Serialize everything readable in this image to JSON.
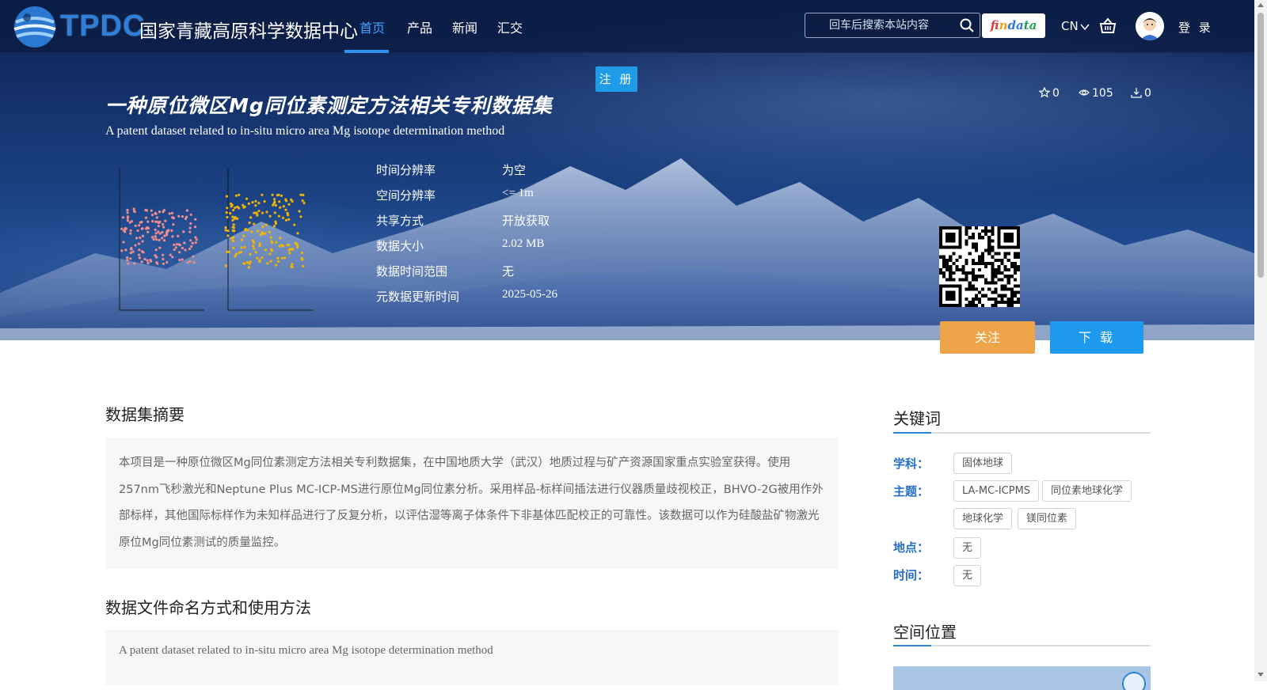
{
  "header": {
    "logo_abbr": "TPDC",
    "logo_name": "国家青藏高原科学数据中心",
    "nav": [
      {
        "label": "首页",
        "active": true
      },
      {
        "label": "产品",
        "active": false
      },
      {
        "label": "新闻",
        "active": false
      },
      {
        "label": "汇交",
        "active": false
      }
    ],
    "search_placeholder": "回车后搜索本站内容",
    "findata": [
      "f",
      "in",
      "da",
      "ta"
    ],
    "lang": "CN",
    "login": "登 录"
  },
  "register_label": "注 册",
  "dataset": {
    "title_cn": "一种原位微区Mg同位素测定方法相关专利数据集",
    "title_en": "A patent dataset related to in-situ micro area Mg isotope determination method",
    "stats": {
      "stars": "0",
      "views": "105",
      "downloads": "0"
    },
    "meta": [
      {
        "key": "时间分辨率",
        "value": "为空"
      },
      {
        "key": "空间分辨率",
        "value": "<= 1m"
      },
      {
        "key": "共享方式",
        "value": "开放获取"
      },
      {
        "key": "数据大小",
        "value": "2.02 MB"
      },
      {
        "key": "数据时间范围",
        "value": "无"
      },
      {
        "key": "元数据更新时间",
        "value": "2025-05-26"
      }
    ]
  },
  "actions": {
    "follow": "关注",
    "download": "下 载"
  },
  "abstract": {
    "title": "数据集摘要",
    "text": "本项目是一种原位微区Mg同位素测定方法相关专利数据集，在中国地质大学（武汉）地质过程与矿产资源国家重点实验室获得。使用257nm飞秒激光和Neptune Plus MC-ICP-MS进行原位Mg同位素分析。采用样品-标样间插法进行仪器质量歧视校正，BHVO-2G被用作外部标样，其他国际标样作为未知样品进行了反复分析，以评估湿等离子体条件下非基体匹配校正的可靠性。该数据可以作为硅酸盐矿物激光原位Mg同位素测试的质量监控。"
  },
  "naming": {
    "title": "数据文件命名方式和使用方法",
    "text": "A patent dataset related to in-situ micro area Mg isotope determination method"
  },
  "keywords": {
    "title": "关键词",
    "groups": [
      {
        "label": "学科：",
        "tags": [
          "固体地球"
        ]
      },
      {
        "label": "主题：",
        "tags": [
          "LA-MC-ICPMS",
          "同位素地球化学",
          "地球化学",
          "镁同位素"
        ]
      },
      {
        "label": "地点：",
        "tags": [
          "无"
        ]
      },
      {
        "label": "时间：",
        "tags": [
          "无"
        ]
      }
    ]
  },
  "spatial": {
    "title": "空间位置"
  },
  "colors": {
    "accent": "#2d94f0",
    "follow": "#eea54a",
    "download": "#1d9aee",
    "label_blue": "#2470c8"
  }
}
